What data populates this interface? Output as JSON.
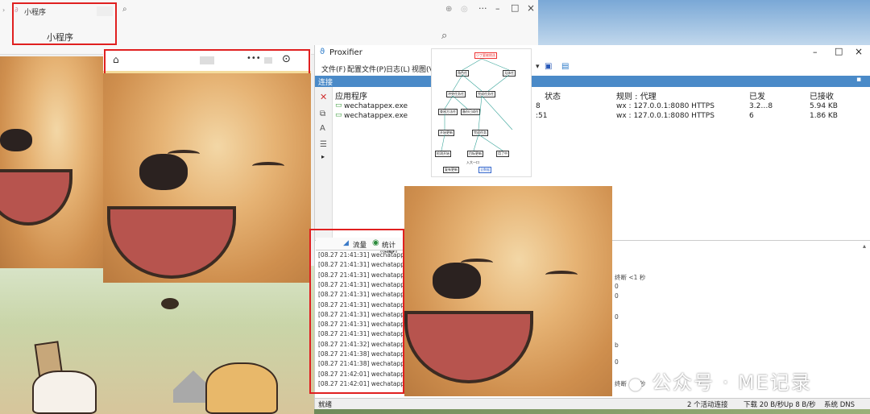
{
  "miniprogram": {
    "tab_title": "小程序",
    "header_title": "小程序",
    "window_controls": {
      "more": "···",
      "minimize": "–",
      "maximize": "□",
      "close": "×"
    }
  },
  "proxifier": {
    "title": "Proxifier",
    "menu": [
      "文件(F)",
      "配置文件(P)",
      "日志(L)",
      "视图(V)"
    ],
    "section_label": "连接",
    "columns": [
      "应用程序",
      "状态",
      "规则 : 代理",
      "已发",
      "已接收"
    ],
    "rows": [
      {
        "app": "wechatappex.exe",
        "status": "8",
        "rule": "wx : 127.0.0.1:8080 HTTPS",
        "sent": "3.2…8",
        "received": "5.94 KB"
      },
      {
        "app": "wechatappex.exe",
        "status": ":51",
        "rule": "wx : 127.0.0.1:8080 HTTPS",
        "sent": "6",
        "received": "1.86 KB"
      }
    ],
    "tabs": [
      "流量",
      "统计"
    ],
    "log_lines": [
      "[08.27 21:41:31] wechatappex.exe -",
      "[08.27 21:41:31] wechatappex.exe -",
      "[08.27 21:41:31] wechatappex.exe -",
      "[08.27 21:41:31] wechatappex.exe -",
      "[08.27 21:41:31] wechatappex.exe -",
      "[08.27 21:41:31] wechatappex.exe -",
      "[08.27 21:41:31] wechatappex.exe -",
      "[08.27 21:41:31] wechatappex.exe -",
      "[08.27 21:41:31] wechatappex.exe -",
      "[08.27 21:41:32] wechatappex.exe -",
      "[08.27 21:41:38] wechatappex.exe -",
      "[08.27 21:41:38] wechatappex.exe -",
      "[08.27 21:42:01] wechatappex.exe -",
      "[08.27 21:42:01] wechatappex.exe -"
    ],
    "log_right": [
      "终断 <1 秒",
      "0",
      "0",
      "0",
      "b",
      "0",
      "终断 <1 秒"
    ],
    "status": {
      "left": "就绪",
      "active": "2 个活动连接",
      "down": "下载 20 B/秒",
      "up": "Up 8 B/秒",
      "dns": "系统 DNS"
    }
  },
  "flowchart": {
    "top": "小丁要被挑选",
    "nodes": [
      "角色任",
      "无体任",
      "冲突任务任",
      "完成任务任",
      "查阅方法任",
      "备份已成任",
      "开始更新",
      "完成任务",
      "检测开始",
      "目标更新",
      "用了中",
      "复有更新",
      "入大一口",
      "全数据"
    ]
  },
  "watermark": "公众号 · ME记录"
}
